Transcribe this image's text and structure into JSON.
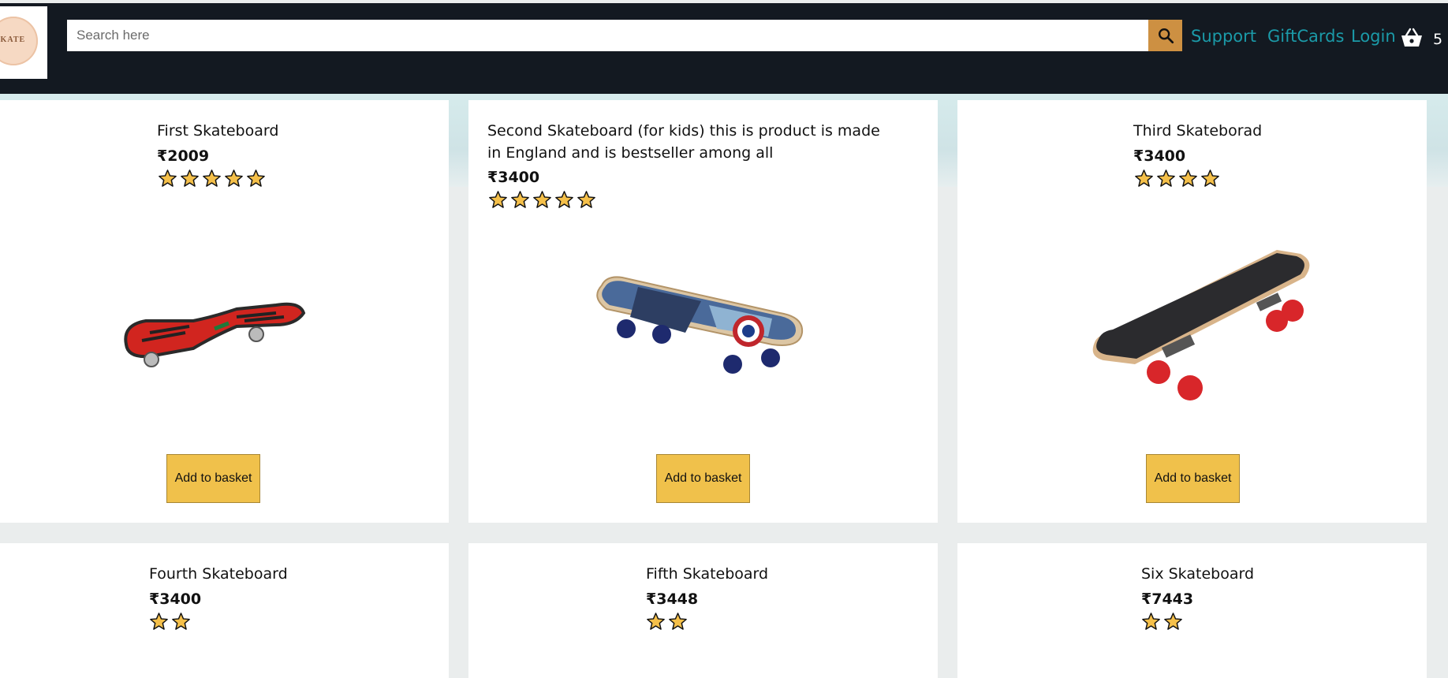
{
  "header": {
    "logo_text": "SKATE",
    "search": {
      "placeholder": "Search here",
      "value": ""
    },
    "nav": {
      "support": "Support",
      "giftcards": "GiftCards",
      "login": "Login"
    },
    "basket_count": "5"
  },
  "products": [
    {
      "title": "First Skateboard",
      "price": "₹2009",
      "rating": 5,
      "button": "Add to basket"
    },
    {
      "title": "Second Skateboard (for kids) this is product is made in England and is bestseller among all",
      "price": "₹3400",
      "rating": 5,
      "button": "Add to basket"
    },
    {
      "title": "Third Skateborad",
      "price": "₹3400",
      "rating": 4,
      "button": "Add to basket"
    },
    {
      "title": "Fourth Skateboard",
      "price": "₹3400",
      "rating": 2
    },
    {
      "title": "Fifth Skateboard",
      "price": "₹3448",
      "rating": 2
    },
    {
      "title": "Six Skateboard",
      "price": "₹7443",
      "rating": 2
    }
  ],
  "colors": {
    "header_bg": "#131921",
    "search_button": "#cd9042",
    "nav_link": "#1b9aa8",
    "button_bg": "#f0c14b",
    "star": "#f5c04a"
  }
}
